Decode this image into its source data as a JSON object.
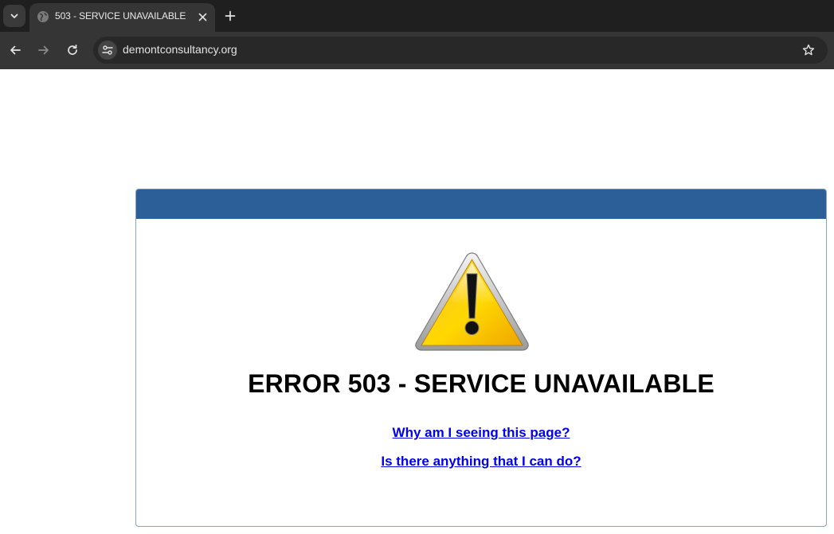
{
  "browser": {
    "tab": {
      "title": "503 - SERVICE UNAVAILABLE",
      "favicon": "globe-icon"
    },
    "tab_search_icon": "chevron-down-icon",
    "new_tab_icon": "plus-icon",
    "toolbar": {
      "back_icon": "arrow-left-icon",
      "forward_icon": "arrow-right-icon",
      "reload_icon": "reload-icon",
      "site_info_icon": "tune-icon",
      "url": "demontconsultancy.org",
      "bookmark_icon": "star-icon"
    }
  },
  "page": {
    "header_color": "#2c5f97",
    "warning_icon": "warning-triangle-icon",
    "error_title": "ERROR 503 - SERVICE UNAVAILABLE",
    "links": [
      {
        "label": "Why am I seeing this page?"
      },
      {
        "label": "Is there anything that I can do?"
      }
    ],
    "link_color": "#0000ee"
  }
}
